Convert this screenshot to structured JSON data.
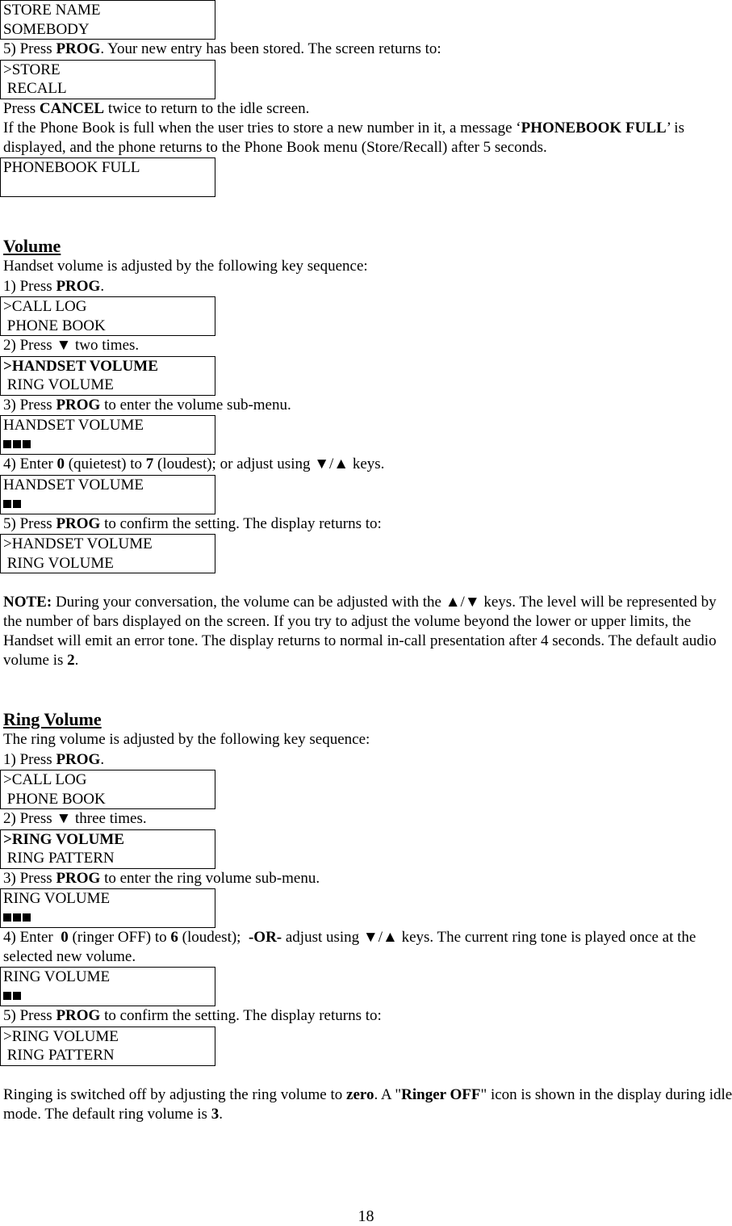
{
  "phonebook_section": {
    "box_store_name": {
      "line1": "STORE NAME",
      "line2": "SOMEBODY"
    },
    "step5": {
      "num": "5) Press ",
      "key": "PROG",
      "rest": ".  Your new entry has been stored.  The screen returns to:"
    },
    "box_store_recall": {
      "line1": ">STORE",
      "line2": " RECALL"
    },
    "cancel_line": {
      "pre": "Press ",
      "key": "CANCEL",
      "rest": " twice to return to the idle screen."
    },
    "full_para": {
      "pre": "If the Phone Book is full when the user tries to store a new number in it, a message ‘",
      "key": "PHONEBOOK FULL",
      "rest": "’ is displayed, and the phone returns to the Phone Book menu (Store/Recall) after 5 seconds."
    },
    "box_full": {
      "line1": "PHONEBOOK FULL",
      "line2": ""
    }
  },
  "volume_section": {
    "heading": "Volume",
    "intro": "Handset volume is adjusted by the following key sequence:",
    "step1": {
      "num": "1) Press ",
      "key": "PROG",
      "rest": "."
    },
    "box1": {
      "line1": ">CALL LOG",
      "line2": " PHONE BOOK"
    },
    "step2": "2) Press ▼ two times.",
    "box2": {
      "line1": ">HANDSET VOLUME",
      "line2": " RING VOLUME"
    },
    "step3": {
      "num": "3) Press ",
      "key": "PROG",
      "rest": " to enter the volume sub-menu."
    },
    "box3": {
      "line1": "HANDSET VOLUME",
      "bars": 3
    },
    "step4": {
      "pre": "4) Enter ",
      "k1": "0",
      "mid": " (quietest) to ",
      "k2": "7",
      "rest": " (loudest); or adjust using ▼/▲ keys."
    },
    "box4": {
      "line1": "HANDSET VOLUME",
      "bars": 2
    },
    "step5": {
      "num": "5) Press ",
      "key": "PROG",
      "rest": " to confirm the setting.  The display returns to:"
    },
    "box5": {
      "line1": ">HANDSET VOLUME",
      "line2": " RING VOLUME"
    },
    "note": {
      "label": "NOTE:",
      "text": " During your conversation, the volume can be adjusted with the ▲/▼ keys. The level will be represented by the number of bars displayed on the screen. If you try to adjust the volume beyond the lower or upper limits, the Handset will emit an error tone. The display returns to normal in-call presentation after 4 seconds.  The default audio volume is ",
      "value": "2",
      "end": "."
    }
  },
  "ring_section": {
    "heading": "Ring Volume",
    "intro": "The ring volume is adjusted by the following key sequence:",
    "step1": {
      "num": "1) Press ",
      "key": "PROG",
      "rest": "."
    },
    "box1": {
      "line1": ">CALL LOG",
      "line2": " PHONE BOOK"
    },
    "step2": "2) Press ▼ three times.",
    "box2": {
      "line1": ">RING VOLUME",
      "line2": " RING PATTERN"
    },
    "step3": {
      "num": "3) Press ",
      "key": "PROG",
      "rest": " to enter the ring volume sub-menu."
    },
    "box3": {
      "line1": "RING VOLUME",
      "bars": 3
    },
    "step4": {
      "pre": "4) Enter  ",
      "k1": "0",
      "mid": " (ringer OFF) to ",
      "k2": "6",
      "mid2": " (loudest);  ",
      "k3": "-OR-",
      "rest": "  adjust using ▼/▲ keys. The current ring tone is played once at the selected new volume."
    },
    "box4": {
      "line1": "RING VOLUME",
      "bars": 2
    },
    "step5": {
      "num": "5) Press ",
      "key": "PROG",
      "rest": " to confirm the setting.  The display returns to:"
    },
    "box5": {
      "line1": ">RING VOLUME",
      "line2": " RING PATTERN"
    },
    "final": {
      "pre": "Ringing is switched off by adjusting the ring volume to ",
      "k1": "zero",
      "mid": ". A \"",
      "k2": "Ringer OFF",
      "mid2": "\" icon is shown in the display during idle mode.  The default ring volume is ",
      "k3": "3",
      "end": "."
    }
  },
  "page_number": "18"
}
